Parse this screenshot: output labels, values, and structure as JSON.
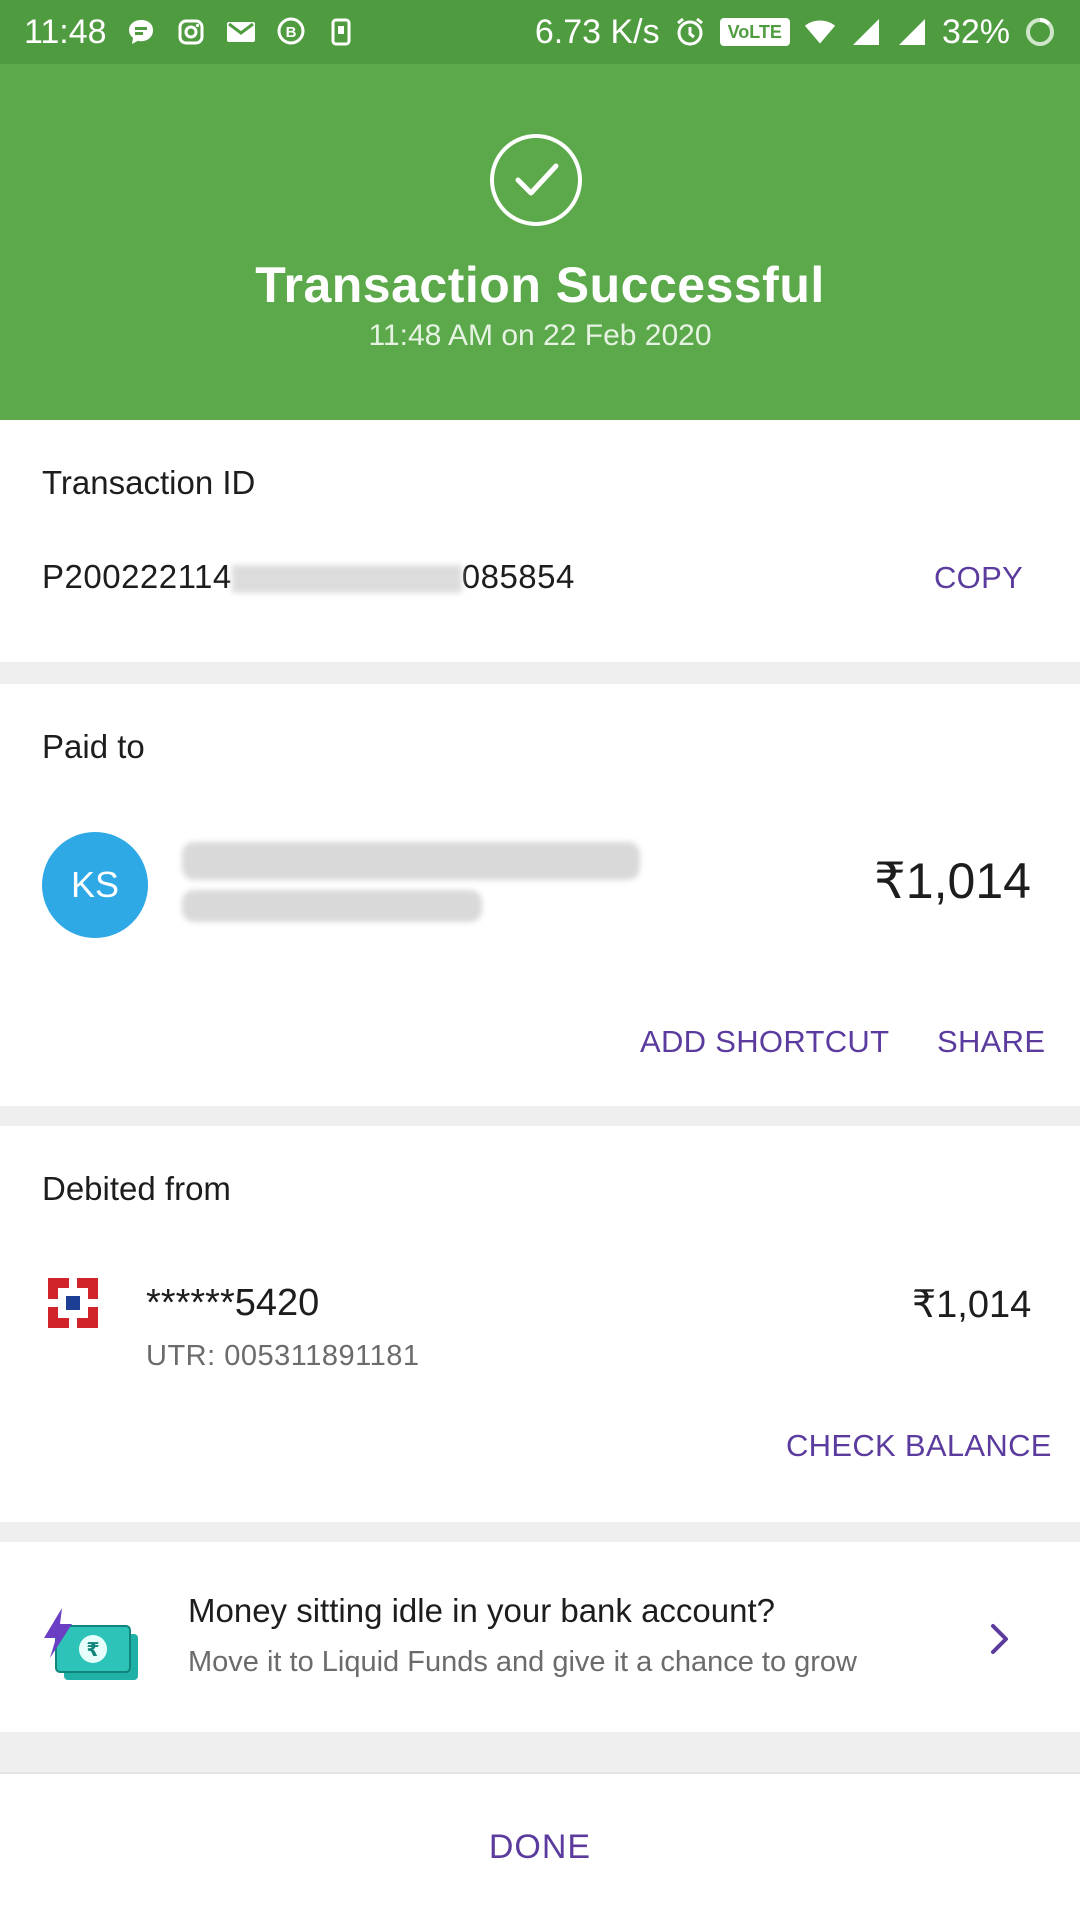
{
  "status_bar": {
    "time": "11:48",
    "network_speed": "6.73 K/s",
    "volte": "VoLTE",
    "battery": "32%"
  },
  "header": {
    "title": "Transaction Successful",
    "subtitle": "11:48 AM on 22 Feb 2020",
    "bg_color": "#5ca94b"
  },
  "transaction": {
    "label": "Transaction ID",
    "id_prefix": "P200222114",
    "id_suffix": "085854",
    "copy_label": "COPY"
  },
  "paid_to": {
    "label": "Paid to",
    "avatar_initials": "KS",
    "amount": "₹1,014",
    "add_shortcut_label": "ADD SHORTCUT",
    "share_label": "SHARE"
  },
  "debited_from": {
    "label": "Debited from",
    "account": "******5420",
    "utr": "UTR: 005311891181",
    "amount": "₹1,014",
    "check_balance_label": "CHECK BALANCE"
  },
  "promo": {
    "title": "Money sitting idle in your bank account?",
    "subtitle": "Move it to Liquid Funds and give it a chance to grow"
  },
  "footer": {
    "done_label": "DONE"
  },
  "colors": {
    "accent": "#5b3c9e",
    "success": "#5ca94b",
    "avatar": "#2fa8e6",
    "bank_red": "#d1232a",
    "bank_blue": "#1c3f95"
  }
}
